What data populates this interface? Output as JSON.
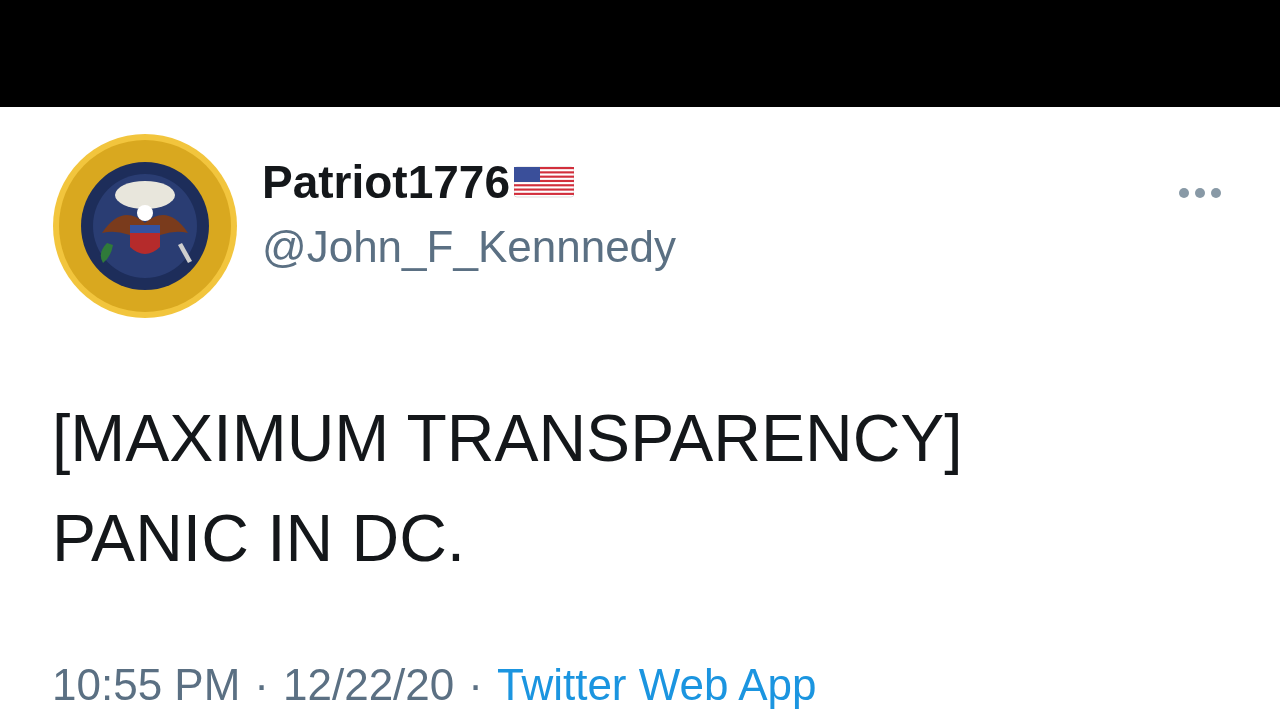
{
  "tweet": {
    "display_name": "Patriot1776",
    "handle": "@John_F_Kennnedy",
    "lines": [
      "[MAXIMUM TRANSPARENCY]",
      "PANIC IN DC."
    ],
    "time": "10:55 PM",
    "separator_1": "·",
    "date": "12/22/20",
    "separator_2": "·",
    "source": "Twitter Web App"
  }
}
